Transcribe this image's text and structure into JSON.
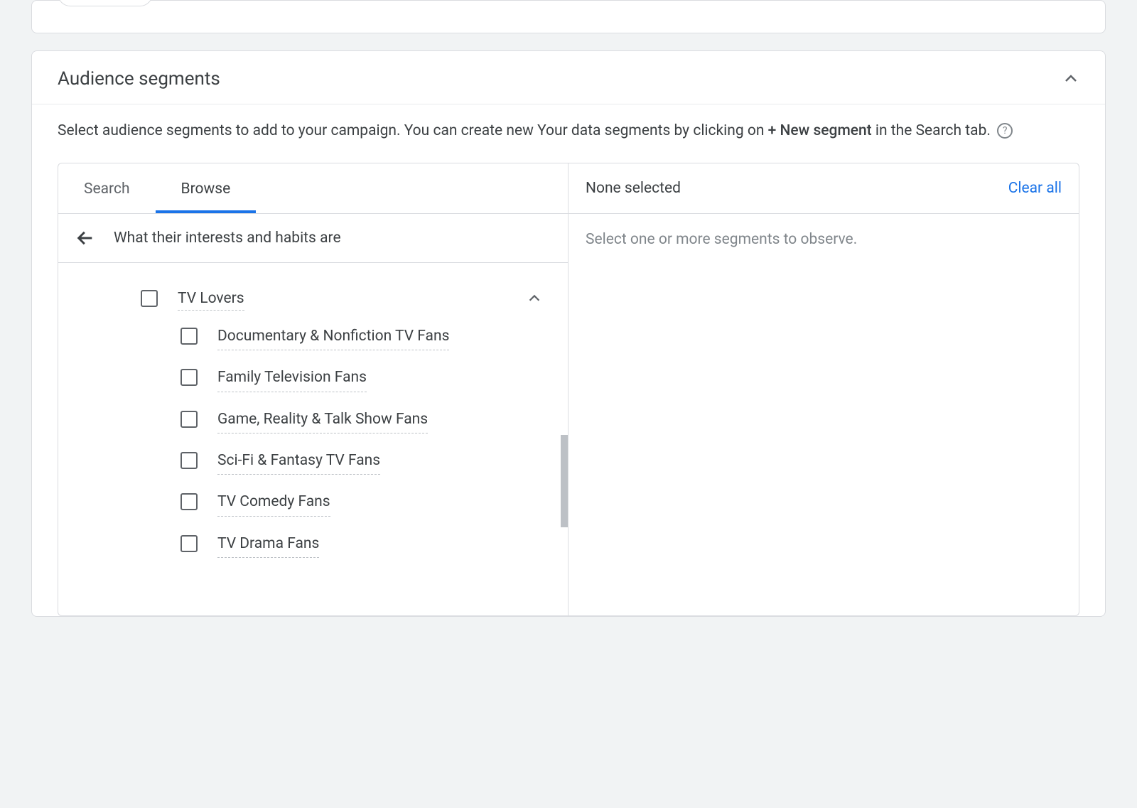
{
  "card": {
    "title": "Audience segments",
    "description_pre": "Select audience segments to add to your campaign. You can create new Your data segments by clicking on ",
    "description_bold": "+ New segment",
    "description_post": " in the Search tab."
  },
  "tabs": {
    "search": "Search",
    "browse": "Browse"
  },
  "breadcrumb": "What their interests and habits are",
  "parent_item": {
    "label": "TV Lovers"
  },
  "children": [
    {
      "label": "Documentary & Nonfiction TV Fans"
    },
    {
      "label": "Family Television Fans"
    },
    {
      "label": "Game, Reality & Talk Show Fans"
    },
    {
      "label": "Sci-Fi & Fantasy TV Fans"
    },
    {
      "label": "TV Comedy Fans"
    },
    {
      "label": "TV Drama Fans"
    }
  ],
  "right": {
    "header": "None selected",
    "clear": "Clear all",
    "body": "Select one or more segments to observe."
  }
}
